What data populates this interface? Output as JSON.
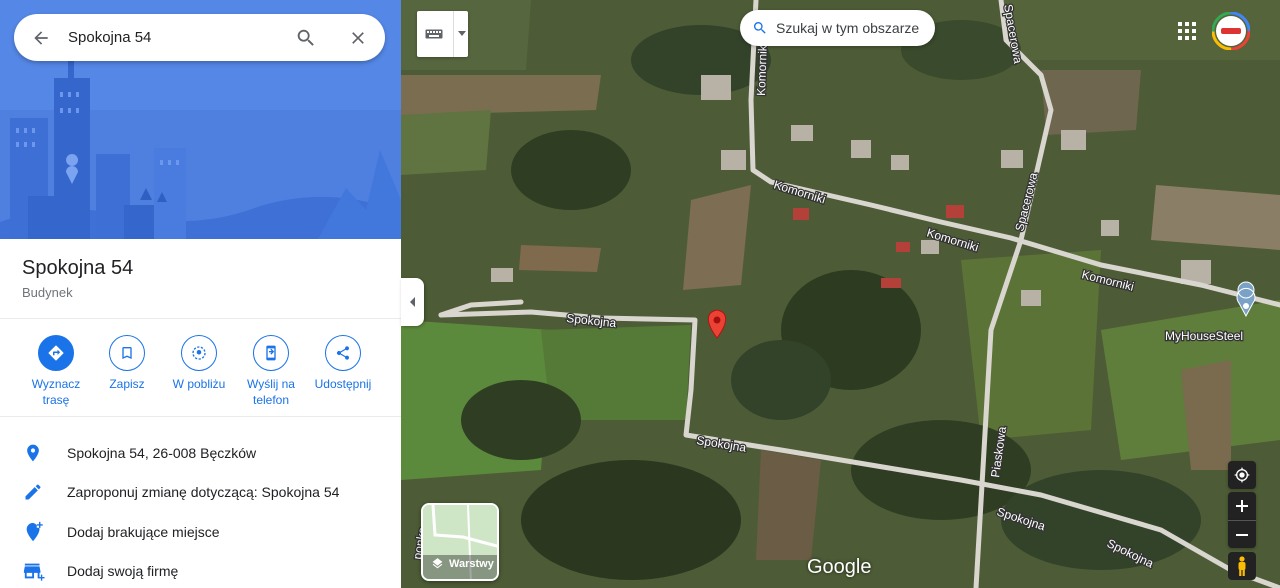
{
  "search": {
    "value": "Spokojna 54"
  },
  "place": {
    "title": "Spokojna 54",
    "type": "Budynek"
  },
  "actions": [
    {
      "label_line1": "Wyznacz",
      "label_line2": "trasę",
      "icon": "directions-icon"
    },
    {
      "label_line1": "Zapisz",
      "label_line2": "",
      "icon": "bookmark-icon"
    },
    {
      "label_line1": "W pobliżu",
      "label_line2": "",
      "icon": "nearby-icon"
    },
    {
      "label_line1": "Wyślij na",
      "label_line2": "telefon",
      "icon": "send-to-phone-icon"
    },
    {
      "label_line1": "Udostępnij",
      "label_line2": "",
      "icon": "share-icon"
    }
  ],
  "info_rows": [
    {
      "text": "Spokojna 54, 26-008 Bęczków",
      "icon": "location-pin-icon"
    },
    {
      "text": "Zaproponuj zmianę dotyczącą: Spokojna 54",
      "icon": "pencil-icon"
    },
    {
      "text": "Dodaj brakujące miejsce",
      "icon": "add-place-icon"
    },
    {
      "text": "Dodaj swoją firmę",
      "icon": "add-business-icon"
    }
  ],
  "map": {
    "search_area_label": "Szukaj w tym obszarze",
    "layers_label": "Warstwy",
    "logo_text": "Google",
    "poi_label": "MyHouseSteel",
    "streets": {
      "komorniki": "Komorniki",
      "spokojna": "Spokojna",
      "piaskowa": "Piaskowa",
      "spacerowa": "Spacerowa",
      "partial_left": "ponka"
    }
  },
  "colors": {
    "accent": "#1a73e8",
    "pin": "#ea4335",
    "hero_bg": "#4f80e0"
  }
}
